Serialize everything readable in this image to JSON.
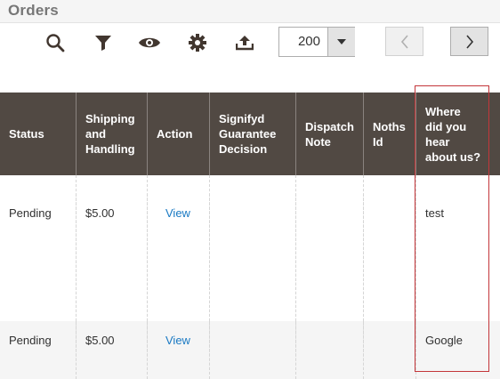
{
  "page": {
    "title": "Orders"
  },
  "toolbar": {
    "icons": [
      "search-icon",
      "filter-icon",
      "eye-icon",
      "gear-icon",
      "upload-icon"
    ],
    "per_page": "200"
  },
  "table": {
    "columns": [
      "Status",
      "Shipping\nand\nHandling",
      "Action",
      "Signifyd\nGuarantee\nDecision",
      "Dispatch\nNote",
      "Noths\nId",
      "Where\ndid you\nhear\nabout us?"
    ],
    "rows": [
      {
        "status": "Pending",
        "shipping": "$5.00",
        "action": "View",
        "signifyd": "",
        "dispatch": "",
        "noths": "",
        "where": "test"
      },
      {
        "status": "Pending",
        "shipping": "$5.00",
        "action": "View",
        "signifyd": "",
        "dispatch": "",
        "noths": "",
        "where": "Google"
      }
    ]
  },
  "colors": {
    "header_bg": "#514943",
    "link": "#1979c3",
    "highlight": "#c3363a"
  }
}
